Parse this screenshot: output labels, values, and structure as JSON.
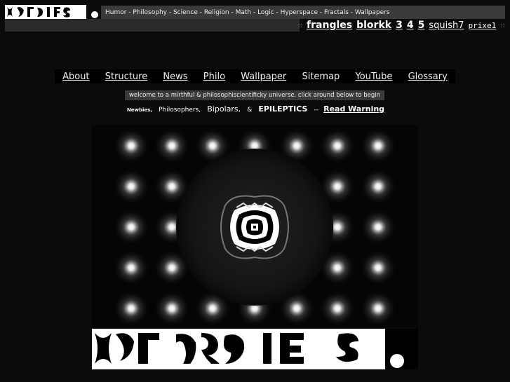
{
  "header": {
    "logo_alt": "frangles",
    "tagline": "Humor - Philosophy - Science - Religion  - Math - Logic - Hyperspace - Fractals - Wallpapers",
    "site_links": [
      {
        "label": "frangles",
        "style": "big"
      },
      {
        "label": "blorkk",
        "style": "big"
      },
      {
        "label": "3",
        "style": "big"
      },
      {
        "label": "4",
        "style": "big"
      },
      {
        "label": "5",
        "style": "big"
      },
      {
        "label": "squish7",
        "style": "med"
      },
      {
        "label": "prixe1",
        "style": "mono"
      }
    ],
    "separator": "::"
  },
  "nav": {
    "items": [
      "About",
      "Structure",
      "News",
      "Philo",
      "Wallpaper",
      "Sitemap",
      "YouTube",
      "Glossary"
    ]
  },
  "welcome": "welcome to a mirthful & philosophiscientificky universe.  click around below to begin",
  "audience": {
    "newbies": "Newbies,",
    "philosophers": "Philosophers,",
    "bipolars": "Bipolars,",
    "amp": "&",
    "epileptics": "EPILEPTICS",
    "dash": "--",
    "warning": "Read Warning"
  },
  "colors": {
    "background": "#0b0b0b",
    "bar": "#3a3a3a",
    "text": "#ffffff"
  }
}
